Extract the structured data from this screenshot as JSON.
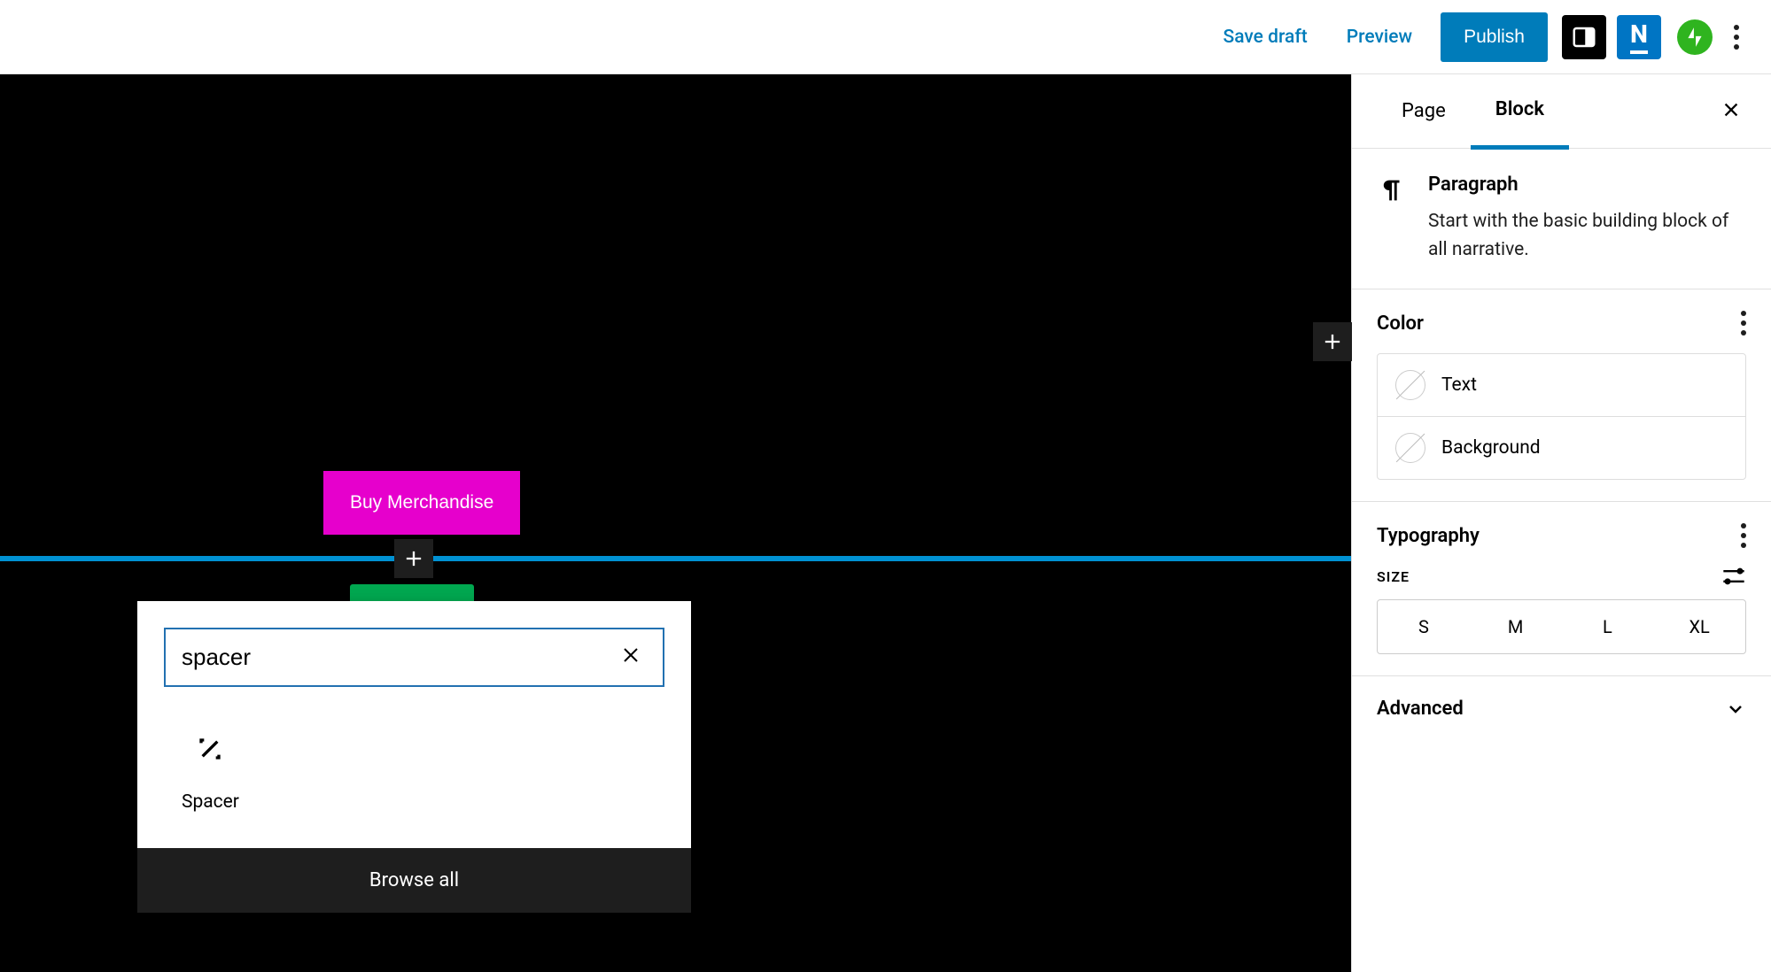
{
  "top": {
    "save_draft": "Save draft",
    "preview": "Preview",
    "publish": "Publish",
    "logo_letter": "N"
  },
  "canvas": {
    "buy_merch": "Buy Merchandise"
  },
  "inserter": {
    "query": "spacer",
    "result_label": "Spacer",
    "browse_all": "Browse all"
  },
  "sidebar": {
    "tabs": {
      "page": "Page",
      "block": "Block"
    },
    "block": {
      "title": "Paragraph",
      "desc": "Start with the basic building block of all narrative."
    },
    "color": {
      "heading": "Color",
      "text": "Text",
      "background": "Background"
    },
    "typography": {
      "heading": "Typography",
      "size_label": "SIZE",
      "sizes": {
        "s": "S",
        "m": "M",
        "l": "L",
        "xl": "XL"
      }
    },
    "advanced": {
      "heading": "Advanced"
    }
  }
}
